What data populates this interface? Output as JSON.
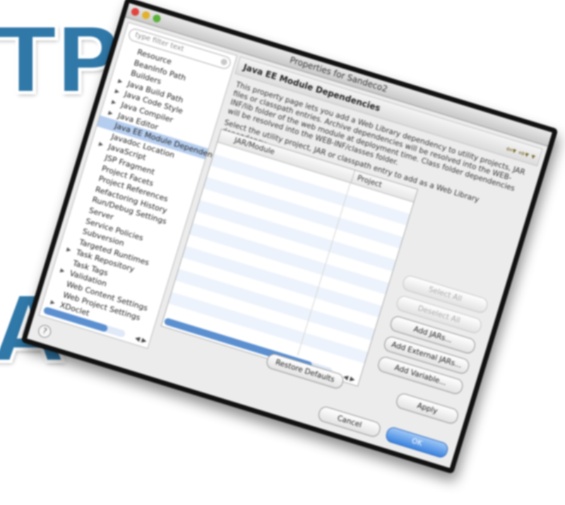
{
  "background": {
    "letters_top": "TP",
    "letters_bottom": "A"
  },
  "window": {
    "title": "Properties for Sandeco2"
  },
  "filter": {
    "placeholder": "type filter text"
  },
  "nav": {
    "items": [
      {
        "label": "Resource",
        "expandable": false
      },
      {
        "label": "BeanInfo Path",
        "expandable": false
      },
      {
        "label": "Builders",
        "expandable": false
      },
      {
        "label": "Java Build Path",
        "expandable": true
      },
      {
        "label": "Java Code Style",
        "expandable": true
      },
      {
        "label": "Java Compiler",
        "expandable": true
      },
      {
        "label": "Java Editor",
        "expandable": true
      },
      {
        "label": "Java EE Module Dependencies",
        "expandable": false,
        "selected": true
      },
      {
        "label": "Javadoc Location",
        "expandable": false
      },
      {
        "label": "JavaScript",
        "expandable": true
      },
      {
        "label": "JSP Fragment",
        "expandable": false
      },
      {
        "label": "Project Facets",
        "expandable": false
      },
      {
        "label": "Project References",
        "expandable": false
      },
      {
        "label": "Refactoring History",
        "expandable": false
      },
      {
        "label": "Run/Debug Settings",
        "expandable": false
      },
      {
        "label": "Server",
        "expandable": false
      },
      {
        "label": "Service Policies",
        "expandable": false
      },
      {
        "label": "Subversion",
        "expandable": false
      },
      {
        "label": "Targeted Runtimes",
        "expandable": false
      },
      {
        "label": "Task Repository",
        "expandable": true
      },
      {
        "label": "Task Tags",
        "expandable": false
      },
      {
        "label": "Validation",
        "expandable": true
      },
      {
        "label": "Web Content Settings",
        "expandable": false
      },
      {
        "label": "Web Project Settings",
        "expandable": false
      },
      {
        "label": "XDoclet",
        "expandable": true
      }
    ]
  },
  "page": {
    "title": "Java EE Module Dependencies",
    "description": "This property page lets you add a Web Library dependency to utility projects, JAR files or classpath entries. Archive dependencies will be resolved into the WEB-INF/lib folder of the web module at deployment time. Class folder dependencies will be resolved into the WEB-INF/classes folder.",
    "instruction": "Select the utility project, JAR or classpath entry to add as a Web Library dependency",
    "columns": [
      "JAR/Module",
      "Project"
    ],
    "row_count": 15
  },
  "buttons": {
    "select_all": "Select All",
    "deselect_all": "Deselect All",
    "add_jars": "Add JARs...",
    "add_external_jars": "Add External JARs...",
    "add_variable": "Add Variable...",
    "restore_defaults": "Restore Defaults",
    "apply": "Apply",
    "cancel": "Cancel",
    "ok": "OK"
  },
  "colors": {
    "selection": "#b5cdef",
    "primary_button": "#3b83df",
    "letters": "#2f78a8"
  }
}
